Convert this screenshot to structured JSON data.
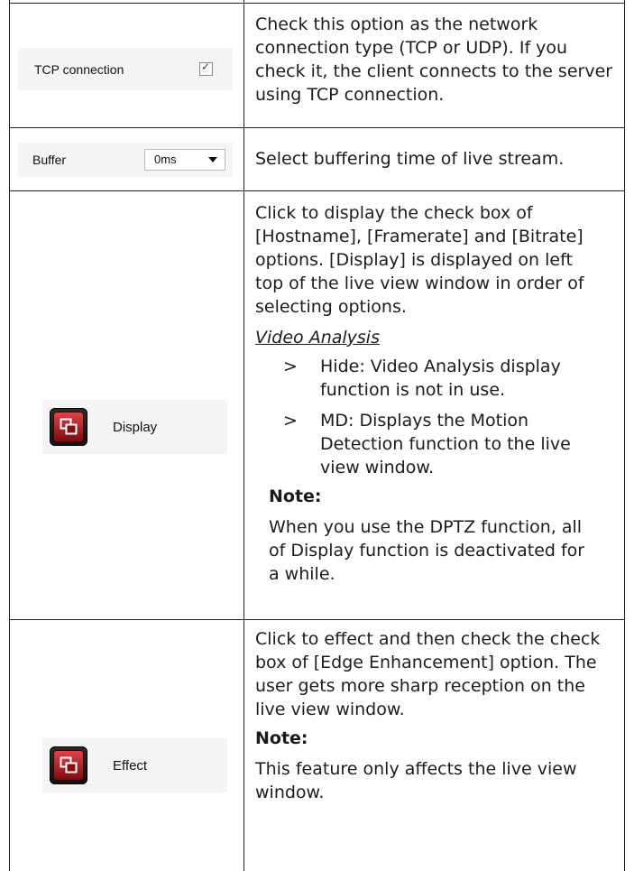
{
  "rows": [
    {
      "ui": {
        "label": "TCP connection",
        "checked": true
      },
      "description": [
        "Check this option as the network",
        "connection type (TCP or UDP). If you",
        "check it, the client connects to the server",
        "using TCP connection."
      ]
    },
    {
      "ui": {
        "label": "Buffer",
        "value": "0ms"
      },
      "description": [
        "Select buffering time of live stream."
      ]
    },
    {
      "ui": {
        "label": "Display",
        "icon": "display-window-icon"
      },
      "description": [
        "Click to display the check box of",
        "[Hostname], [Framerate] and [Bitrate]",
        "options. [Display] is displayed on left",
        "top of the live view window in order of",
        "selecting options."
      ],
      "subheading": "Video Analysis",
      "bullets": [
        {
          "marker": ">",
          "lines": [
            "Hide: Video Analysis display",
            "function is not in use."
          ]
        },
        {
          "marker": ">",
          "lines": [
            "MD: Displays the Motion",
            "Detection function to the live",
            "view window."
          ]
        }
      ],
      "note_title": "Note:",
      "note": [
        "When you use the DPTZ function, all",
        "of Display function is deactivated for",
        "a while."
      ]
    },
    {
      "ui": {
        "label": "Effect",
        "icon": "effect-window-icon"
      },
      "description": [
        "Click to effect and then check the check",
        "box of [Edge Enhancement] option. The",
        "user gets more sharp reception on the",
        "live view window."
      ],
      "note_title": "Note:",
      "note": [
        "This feature only affects the live view",
        "window."
      ]
    }
  ],
  "colors": {
    "accent": "#b2161c",
    "border": "#1f1f1f",
    "strip": "#f4f4f4"
  }
}
